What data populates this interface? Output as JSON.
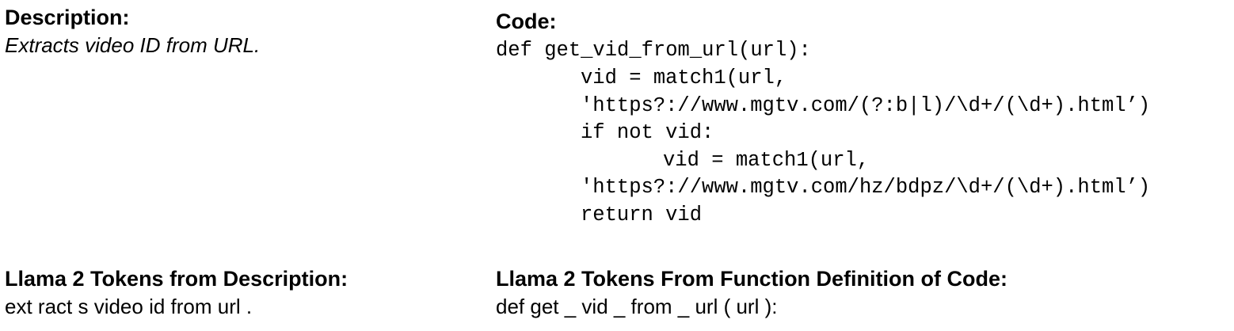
{
  "description": {
    "heading": "Description:",
    "text": "Extracts video ID from URL."
  },
  "code": {
    "heading": "Code:",
    "lines": [
      "def get_vid_from_url(url):",
      "vid = match1(url,",
      "'https?://www.mgtv.com/(?:b|l)/\\d+/(\\d+).html’)",
      "if not vid:",
      "vid = match1(url,",
      "'https?://www.mgtv.com/hz/bdpz/\\d+/(\\d+).html’)",
      "return vid"
    ]
  },
  "tokens_description": {
    "heading": "Llama 2 Tokens from Description:",
    "text": "ext ract s video id from url ."
  },
  "tokens_code": {
    "heading": "Llama 2 Tokens From Function Definition of Code:",
    "text": "def get _ vid _ from _ url ( url ):"
  }
}
